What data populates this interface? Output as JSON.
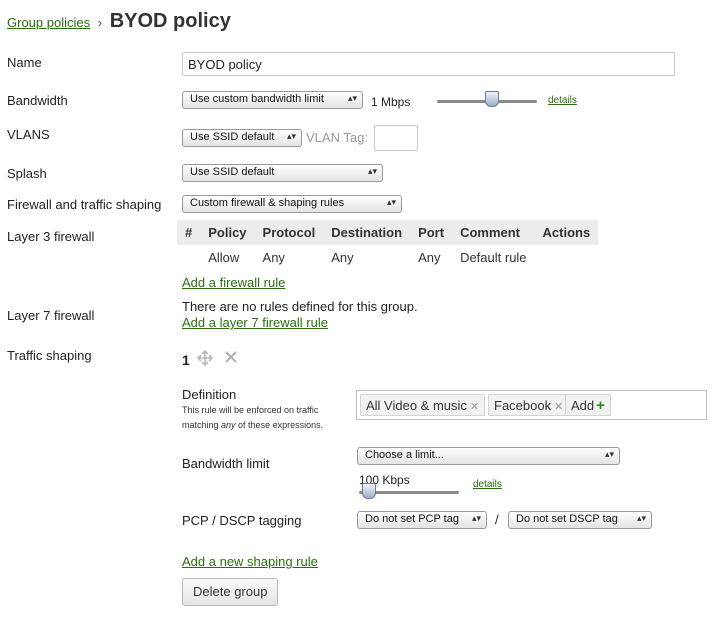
{
  "breadcrumb": {
    "parent": "Group policies",
    "separator": "›",
    "title": "BYOD policy"
  },
  "fields": {
    "name": {
      "label": "Name",
      "value": "BYOD policy"
    },
    "bandwidth": {
      "label": "Bandwidth",
      "select": "Use custom bandwidth limit",
      "value_text": "1 Mbps",
      "details": "details",
      "slider_level_fraction": 0.55
    },
    "vlans": {
      "label": "VLANS",
      "select": "Use SSID default",
      "tag_label": "VLAN Tag:",
      "tag_value": ""
    },
    "splash": {
      "label": "Splash",
      "select": "Use SSID default"
    },
    "firewall": {
      "label": "Firewall and traffic shaping",
      "select": "Custom firewall & shaping rules"
    }
  },
  "layer3": {
    "label": "Layer 3 firewall",
    "columns": [
      "#",
      "Policy",
      "Protocol",
      "Destination",
      "Port",
      "Comment",
      "Actions"
    ],
    "rows": [
      {
        "num": "",
        "policy": "Allow",
        "protocol": "Any",
        "destination": "Any",
        "port": "Any",
        "comment": "Default rule",
        "actions": ""
      }
    ],
    "add_link": "Add a firewall rule"
  },
  "layer7": {
    "label": "Layer 7 firewall",
    "empty_text": "There are no rules defined for this group.",
    "add_link": "Add a layer 7 firewall rule"
  },
  "shaping": {
    "label": "Traffic shaping",
    "rule_number": "1",
    "definition_label": "Definition",
    "definition_hint_1": "This rule will be enforced on traffic matching ",
    "definition_hint_em": "any",
    "definition_hint_2": " of these expressions.",
    "chips": [
      "All Video & music",
      "Facebook"
    ],
    "add_chip": "Add",
    "bandwidth_label": "Bandwidth limit",
    "bandwidth_select": "Choose a limit...",
    "bandwidth_value": "100 Kbps",
    "bandwidth_details": "details",
    "bandwidth_slider_level_fraction": 0.1,
    "pcp_label": "PCP / DSCP tagging",
    "pcp_select": "Do not set PCP tag",
    "pcp_separator": "/",
    "dscp_select": "Do not set DSCP tag",
    "add_link": "Add a new shaping rule"
  },
  "delete_button": "Delete group"
}
